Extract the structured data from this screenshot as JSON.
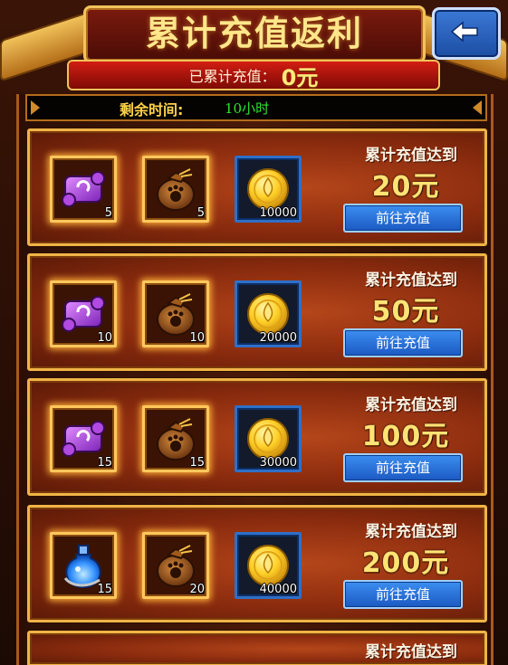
{
  "header": {
    "title": "累计充值返利",
    "total_label": "已累计充值：",
    "total_value": "0元"
  },
  "timer": {
    "label": "剩余时间:",
    "value": "10小时"
  },
  "tiers": [
    {
      "goal_label": "累计充值达到",
      "goal_amount": "20元",
      "button_label": "前往充值",
      "rewards": [
        {
          "item": "scroll-icon",
          "qty": "5"
        },
        {
          "item": "pouch-icon",
          "qty": "5"
        },
        {
          "item": "gold-coin-icon",
          "qty": "10000"
        }
      ]
    },
    {
      "goal_label": "累计充值达到",
      "goal_amount": "50元",
      "button_label": "前往充值",
      "rewards": [
        {
          "item": "scroll-icon",
          "qty": "10"
        },
        {
          "item": "pouch-icon",
          "qty": "10"
        },
        {
          "item": "gold-coin-icon",
          "qty": "20000"
        }
      ]
    },
    {
      "goal_label": "累计充值达到",
      "goal_amount": "100元",
      "button_label": "前往充值",
      "rewards": [
        {
          "item": "scroll-icon",
          "qty": "15"
        },
        {
          "item": "pouch-icon",
          "qty": "15"
        },
        {
          "item": "gold-coin-icon",
          "qty": "30000"
        }
      ]
    },
    {
      "goal_label": "累计充值达到",
      "goal_amount": "200元",
      "button_label": "前往充值",
      "rewards": [
        {
          "item": "potion-icon",
          "qty": "15"
        },
        {
          "item": "pouch-icon",
          "qty": "20"
        },
        {
          "item": "gold-coin-icon",
          "qty": "40000"
        }
      ]
    },
    {
      "goal_label": "累计充值达到"
    }
  ]
}
